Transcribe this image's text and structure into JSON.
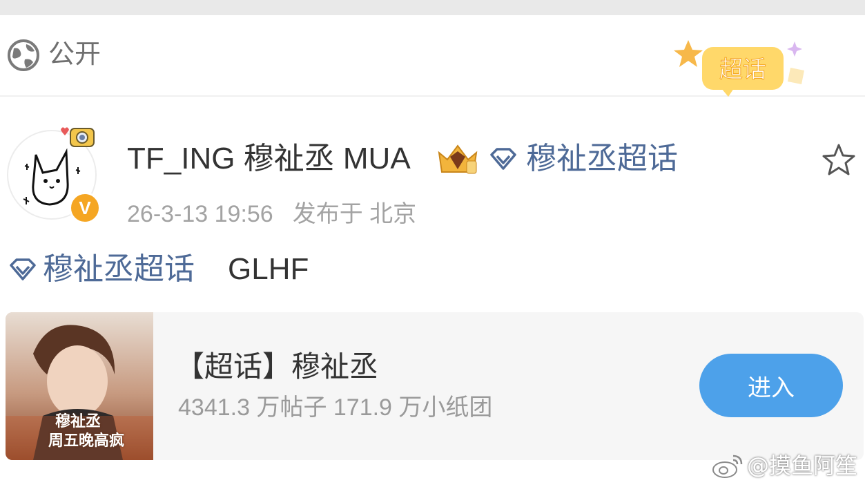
{
  "visibility": {
    "label": "公开",
    "icon": "globe-icon"
  },
  "badge": {
    "label": "超话",
    "icon": "star-icon"
  },
  "post": {
    "username": "TF_ING 穆祉丞 MUA",
    "topic_link": "穆祉丞超话",
    "timestamp": "26-3-13 19:56",
    "location": "发布于 北京",
    "body_topic": "穆祉丞超话",
    "body_text": "GLHF",
    "verified_mark": "V"
  },
  "topic_card": {
    "title": "【超话】穆祉丞",
    "stats": "4341.3 万帖子 171.9 万小纸团",
    "enter_label": "进入",
    "cover_text_line1": "穆祉丞",
    "cover_text_line2": "周五晚高疯"
  },
  "watermark": {
    "text": "@摸鱼阿笙"
  },
  "colors": {
    "link": "#4e6a97",
    "button": "#4da1ea",
    "verified": "#f5a623"
  }
}
